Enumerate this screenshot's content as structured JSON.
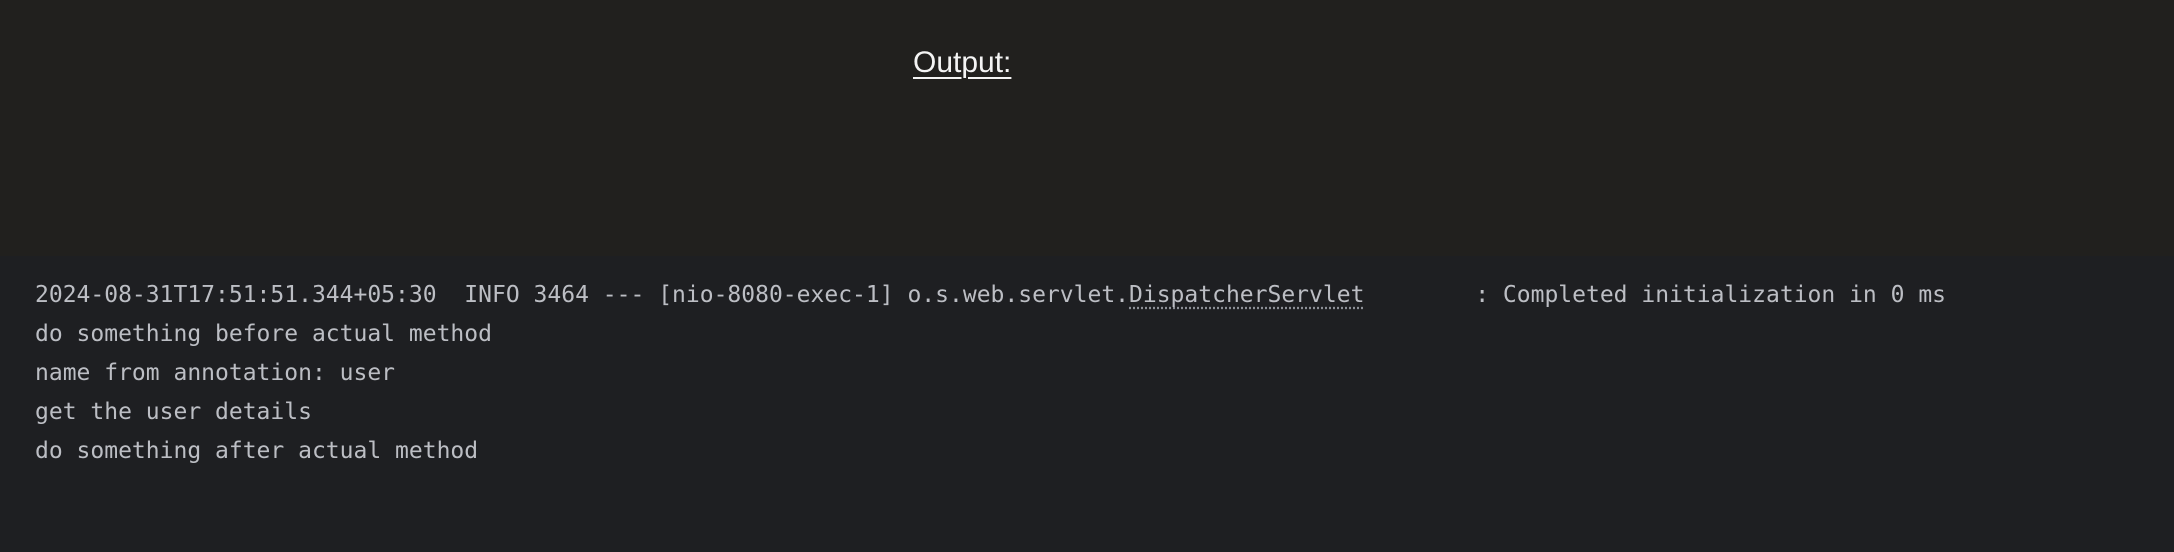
{
  "header": {
    "title": "Output:"
  },
  "console": {
    "log_line": {
      "timestamp": "2024-08-31T17:51:51.344+05:30",
      "level": "INFO",
      "pid": "3464",
      "separator": "---",
      "thread": "[nio-8080-exec-1]",
      "logger_package": "o.s.web.servlet.",
      "logger_class": "DispatcherServlet",
      "message": ": Completed initialization in 0 ms"
    },
    "lines": [
      "do something before actual method",
      "name from annotation: user",
      "get the user details",
      "do something after actual method"
    ]
  }
}
